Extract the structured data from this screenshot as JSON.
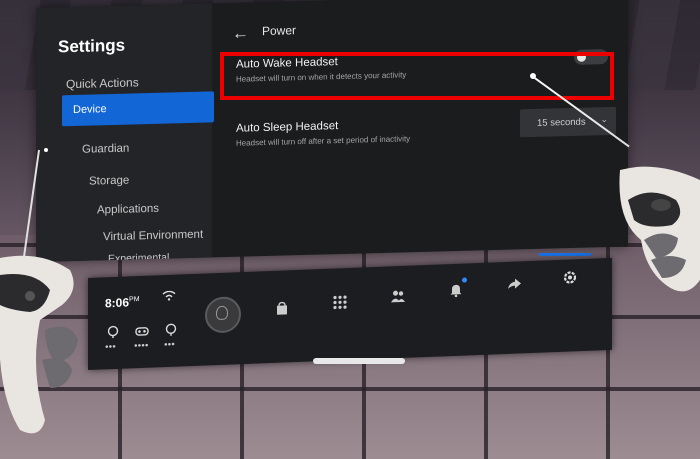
{
  "sidebar": {
    "title": "Settings",
    "items": [
      {
        "label": "Quick Actions"
      },
      {
        "label": "Device"
      },
      {
        "label": "Guardian"
      },
      {
        "label": "Storage"
      },
      {
        "label": "Applications"
      },
      {
        "label": "Virtual Environment"
      },
      {
        "label": "Experimental Features"
      }
    ]
  },
  "header": {
    "title": "Power"
  },
  "settings": {
    "auto_wake": {
      "label": "Auto Wake Headset",
      "description": "Headset will turn on when it detects your activity",
      "enabled": false
    },
    "auto_sleep": {
      "label": "Auto Sleep Headset",
      "description": "Headset will turn off after a set period of inactivity",
      "value": "15 seconds"
    }
  },
  "taskbar": {
    "time": "8:06",
    "ampm": "PM",
    "icons": [
      "wifi-icon",
      "headset-icon",
      "controller-icon",
      "controller-right-icon",
      "avatar",
      "store-icon",
      "apps-grid-icon",
      "people-icon",
      "notifications-icon",
      "share-icon",
      "settings-icon"
    ]
  },
  "colors": {
    "accent": "#1366d6",
    "highlight": "#ee0000",
    "notification": "#2e8bff"
  }
}
